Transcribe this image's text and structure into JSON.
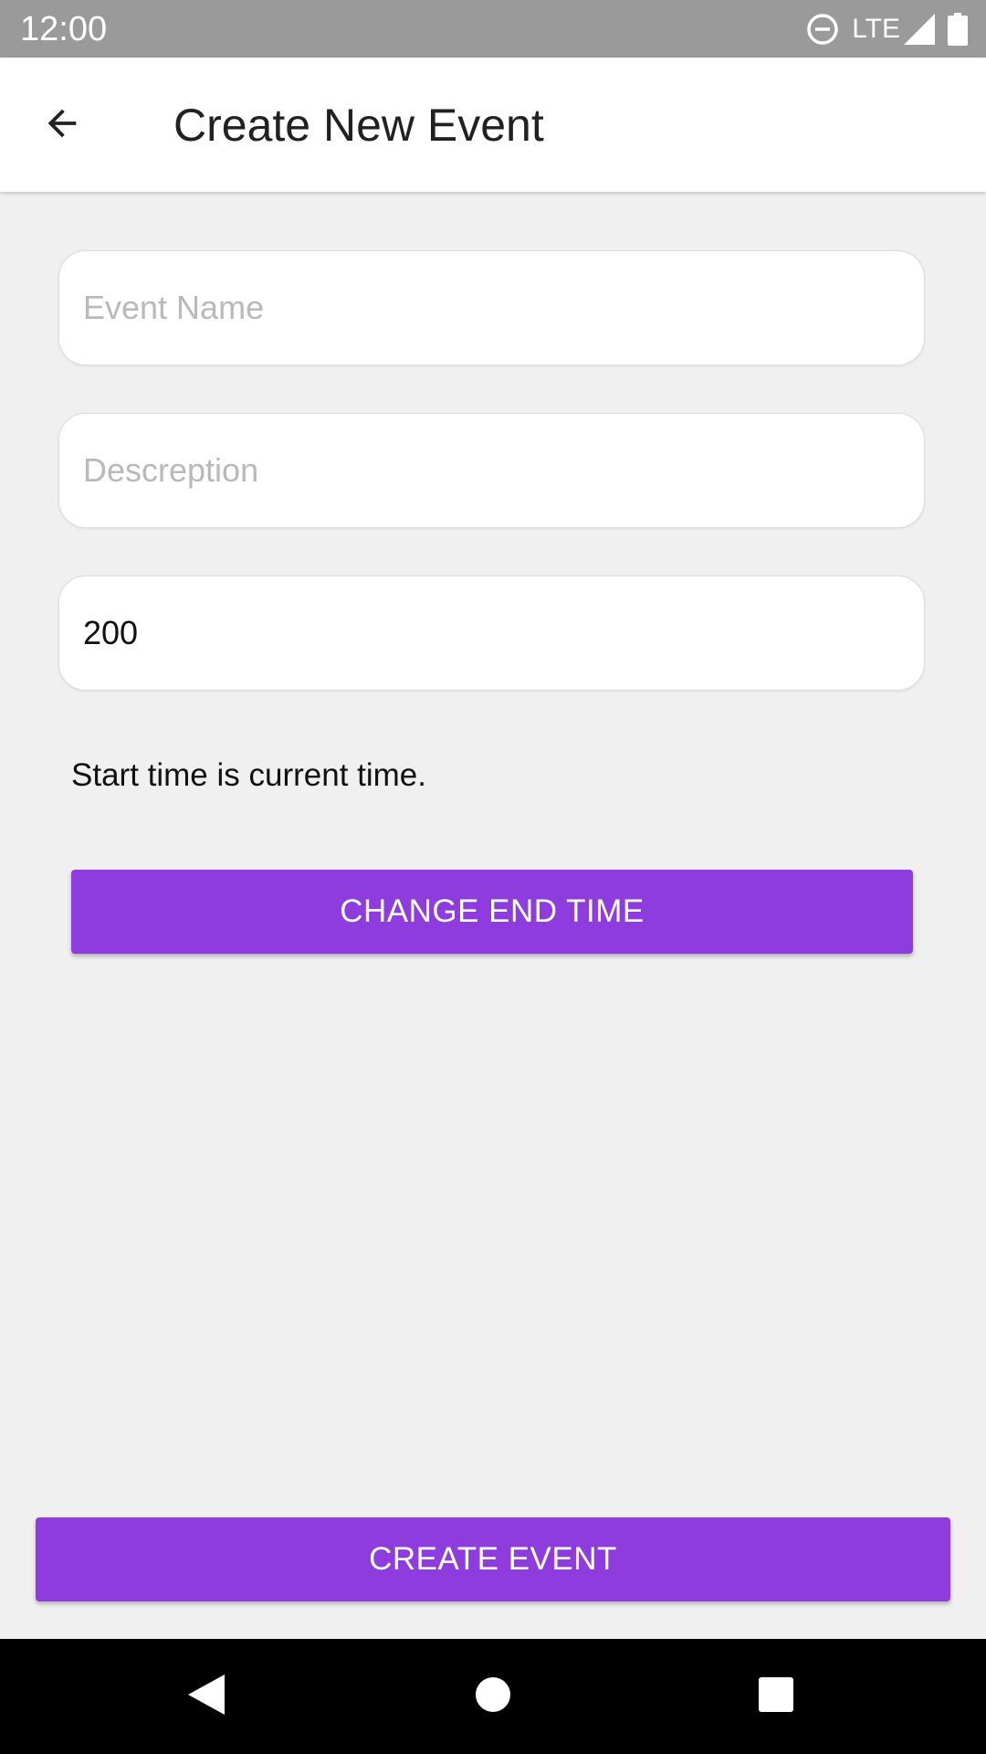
{
  "status_bar": {
    "time": "12:00",
    "network": "LTE",
    "icons": [
      "do-not-disturb-icon",
      "signal-icon",
      "battery-icon"
    ]
  },
  "app_bar": {
    "title": "Create New Event",
    "back_icon": "arrow-back-icon"
  },
  "form": {
    "event_name": {
      "value": "",
      "placeholder": "Event Name"
    },
    "description": {
      "value": "",
      "placeholder": "Descreption"
    },
    "amount": {
      "value": "200",
      "placeholder": ""
    },
    "start_time_note": "Start time is current time.",
    "change_end_time_label": "CHANGE END TIME",
    "create_event_label": "CREATE EVENT"
  },
  "nav_bar": {
    "icons": [
      "nav-back-icon",
      "nav-home-icon",
      "nav-recents-icon"
    ]
  },
  "colors": {
    "accent": "#8e3cde",
    "background": "#f0f0f0",
    "status_bar": "#9a9a9a",
    "nav_bar": "#000000"
  }
}
